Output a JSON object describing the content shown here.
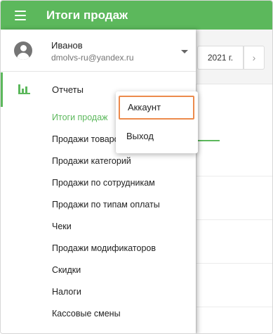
{
  "header": {
    "title": "Итоги продаж"
  },
  "user": {
    "name": "Иванов",
    "email": "dmolvs-ru@yandex.ru"
  },
  "section": {
    "label": "Отчеты"
  },
  "nav": {
    "items": [
      {
        "label": "Итоги продаж",
        "active": true
      },
      {
        "label": "Продажи товаров"
      },
      {
        "label": "Продажи категорий"
      },
      {
        "label": "Продажи по сотрудникам"
      },
      {
        "label": "Продажи по типам оплаты"
      },
      {
        "label": "Чеки"
      },
      {
        "label": "Продажи модификаторов"
      },
      {
        "label": "Скидки"
      },
      {
        "label": "Налоги"
      },
      {
        "label": "Кассовые смены"
      }
    ]
  },
  "dropdown": {
    "account": "Аккаунт",
    "exit": "Выход"
  },
  "background": {
    "date": "2021 г.",
    "next_glyph": "›"
  },
  "colors": {
    "accent": "#5cb85c",
    "highlight_border": "#ec8a4c"
  }
}
